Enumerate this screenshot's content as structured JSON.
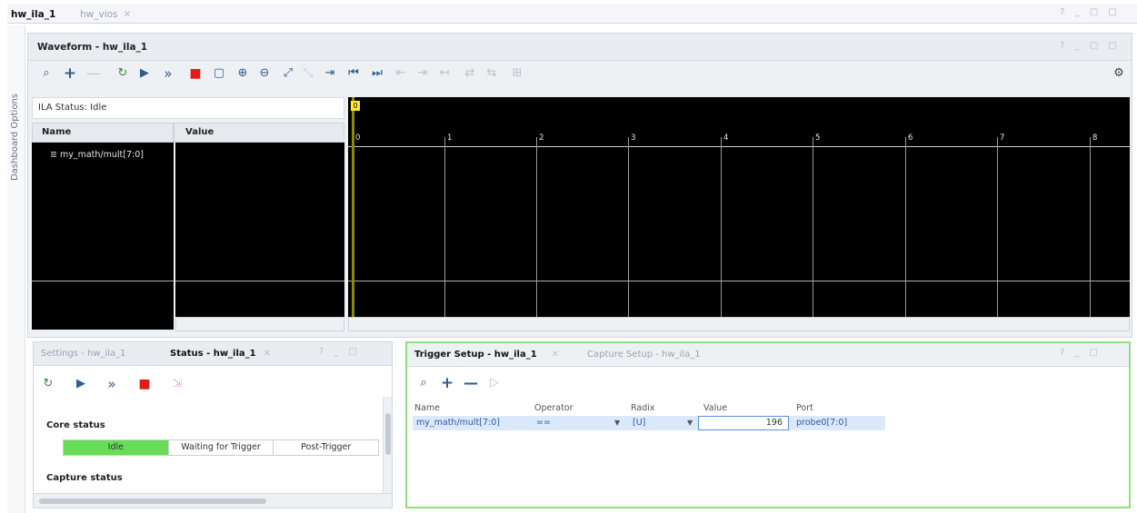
{
  "doc_tabs": {
    "active": "hw_ila_1",
    "inactive": "hw_vios",
    "window_controls": "? _ □ □"
  },
  "dashboard_options": "Dashboard Options",
  "waveform": {
    "title": "Waveform - hw_ila_1",
    "header_controls": "? _ □ □",
    "ila_status": "ILA Status: Idle",
    "name_header": "Name",
    "value_header": "Value",
    "signal": "my_math/mult[7:0]",
    "cursor_label": "0",
    "ticks": [
      "0",
      "1",
      "2",
      "3",
      "4",
      "5",
      "6",
      "7",
      "8"
    ],
    "toolbar_icons": [
      "search-icon",
      "add-icon",
      "remove-icon",
      "run-trigger-immediate-icon",
      "run-trigger-icon",
      "auto-retrigger-icon",
      "stop-icon",
      "export-icon",
      "zoom-in-icon",
      "zoom-out-icon",
      "zoom-fit-icon",
      "go-to-cursor-icon",
      "go-to-start-icon",
      "go-to-end-icon",
      "previous-transition-icon",
      "next-transition-icon",
      "add-marker-icon",
      "swap-cursor-icon",
      "cut-icon",
      "paste-icon",
      "settings-icon"
    ]
  },
  "bottom_left": {
    "tab_settings": "Settings - hw_ila_1",
    "tab_status": "Status - hw_ila_1",
    "controls": "? _ □",
    "core_status_title": "Core status",
    "core_status": [
      "Idle",
      "Waiting for Trigger",
      "Post-Trigger"
    ],
    "capture_status_title": "Capture status"
  },
  "trigger": {
    "tab_trigger": "Trigger Setup - hw_ila_1",
    "tab_capture": "Capture Setup - hw_ila_1",
    "controls": "? _ □",
    "columns": [
      "Name",
      "Operator",
      "Radix",
      "Value",
      "Port"
    ],
    "row": {
      "name": "my_math/mult[7:0]",
      "operator": "==",
      "radix": "[U]",
      "value": "196",
      "port": "probe0[7:0]"
    }
  }
}
